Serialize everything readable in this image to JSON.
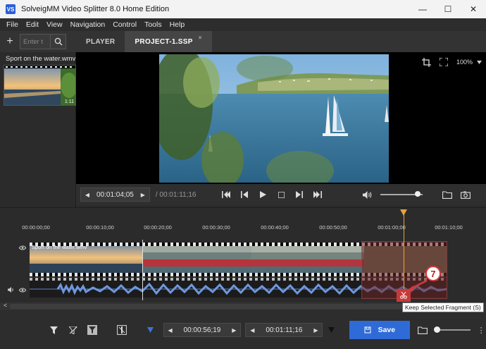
{
  "window": {
    "app_icon": "VS",
    "title": "SolveigMM Video Splitter 8.0 Home Edition",
    "minimize": "—",
    "maximize": "☐",
    "close": "✕"
  },
  "menu": [
    "File",
    "Edit",
    "View",
    "Navigation",
    "Control",
    "Tools",
    "Help"
  ],
  "library": {
    "add_label": "+",
    "search_placeholder": "Enter t",
    "file_name": "Sport on the water.wmv",
    "thumb_duration": "1:11"
  },
  "tabs": [
    {
      "label": "PLAYER",
      "active": false
    },
    {
      "label": "PROJECT-1.SSP",
      "active": true,
      "close": "×"
    }
  ],
  "video": {
    "zoom": "100%"
  },
  "player": {
    "current_time": "00:01:04;05",
    "total_time": "/ 00:01:11;16",
    "volume_level": 0.88
  },
  "timeline": {
    "ticks": [
      "00:00:00;00",
      "00:00:10;00",
      "00:00:20;00",
      "00:00:30;00",
      "00:00:40;00",
      "00:00:50;00",
      "00:01:00;00",
      "00:01:10;00"
    ],
    "clip_name": "Sport on the water.wmv",
    "scroll_left": "<"
  },
  "fragment": {
    "tooltip": "Keep Selected Fragment (S)",
    "badge": "7"
  },
  "bottom": {
    "start_time": "00:00:56;19",
    "end_time": "00:01:11;16",
    "save_label": "Save",
    "more": "⋮"
  },
  "colors": {
    "accent": "#2f6bd7",
    "playhead": "#e8a33a",
    "cut_button": "#c83a3a"
  }
}
